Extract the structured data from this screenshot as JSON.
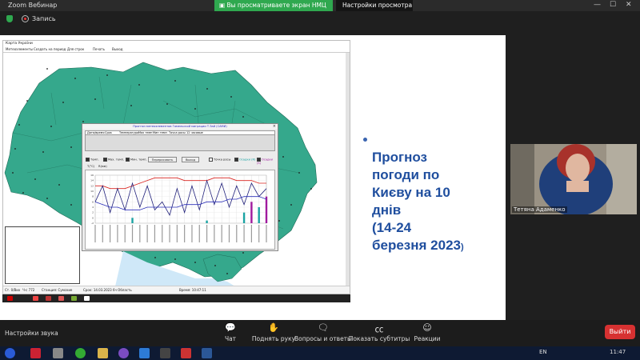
{
  "window": {
    "title": "Zoom Вебинар",
    "controls": [
      "—",
      "☐",
      "✕"
    ]
  },
  "share_banner": {
    "text": "Вы просматриваете экран НМЦ ВФПО",
    "view_options": "Настройки просмотра"
  },
  "recording": {
    "label": "Запись"
  },
  "app": {
    "title": "Карта України",
    "menu": [
      "Метеоэлементы",
      "Создать на период",
      "Для строк",
      "Печать",
      "Выход"
    ],
    "status": [
      "Ст. 0/Вих",
      "Ч-с 772",
      "Станция: Сумские",
      "Срок: 14.03.2023 6ч Область",
      "Время: 10:47:11"
    ]
  },
  "dialog": {
    "title": "Прогноз метеоэлементов Гомельской миграции Т.Зай (САМИ)",
    "columns": [
      "Дата/время",
      "Срок",
      "Температура",
      "Мах темп",
      "Мин темп",
      "Точка росы",
      "12 часовые"
    ],
    "checks": [
      "Темп.",
      "Мах. темп.",
      "Мин. темп."
    ],
    "buttons": [
      "Перерисовать",
      "Выход"
    ],
    "checks_right": [
      "Точка росы",
      "Осадки (R)",
      "Осадки (S)"
    ],
    "chart_left_label": "T(°C)",
    "chart_right_label": "R(мм)"
  },
  "chart_data": {
    "type": "line",
    "ylim": [
      -2,
      16
    ],
    "series": [
      {
        "values": [
          12,
          12,
          11,
          11,
          11,
          12,
          13,
          14,
          15,
          15,
          15,
          15,
          14,
          14,
          14,
          14,
          15,
          15,
          15,
          14,
          14,
          14,
          13,
          13
        ]
      },
      {
        "values": [
          6,
          12,
          2,
          11,
          3,
          13,
          4,
          12,
          3,
          6,
          1,
          11,
          2,
          12,
          3,
          14,
          5,
          13,
          4,
          12,
          5,
          13,
          8,
          11
        ]
      },
      {
        "values": [
          6,
          5,
          4,
          4,
          3,
          3,
          3,
          4,
          4,
          4,
          4,
          4,
          5,
          5,
          5,
          6,
          6,
          6,
          7,
          7,
          8,
          8,
          8,
          7
        ]
      }
    ],
    "bars": {
      "values": [
        0,
        0,
        0,
        0,
        0,
        2,
        0,
        0,
        0,
        0,
        0,
        0,
        0,
        0,
        0,
        1,
        0,
        0,
        0,
        0,
        4,
        8,
        6,
        10
      ]
    }
  },
  "slide_title": {
    "lines": [
      "Прогноз",
      "погоди по",
      "Києву на 10",
      "днів",
      "(14-24",
      "березня 2023"
    ],
    "suffix": ")"
  },
  "video": {
    "name": "Тетяна Адаменко"
  },
  "controls": {
    "audio": "Настройки звука",
    "chat": "Чат",
    "raise_hand": "Поднять руку",
    "qa": "Вопросы и ответы",
    "captions": "Показать субтитры",
    "reactions": "Реакции",
    "exit": "Выйти"
  },
  "taskbar": {
    "lang": "EN",
    "time": "11:47"
  }
}
